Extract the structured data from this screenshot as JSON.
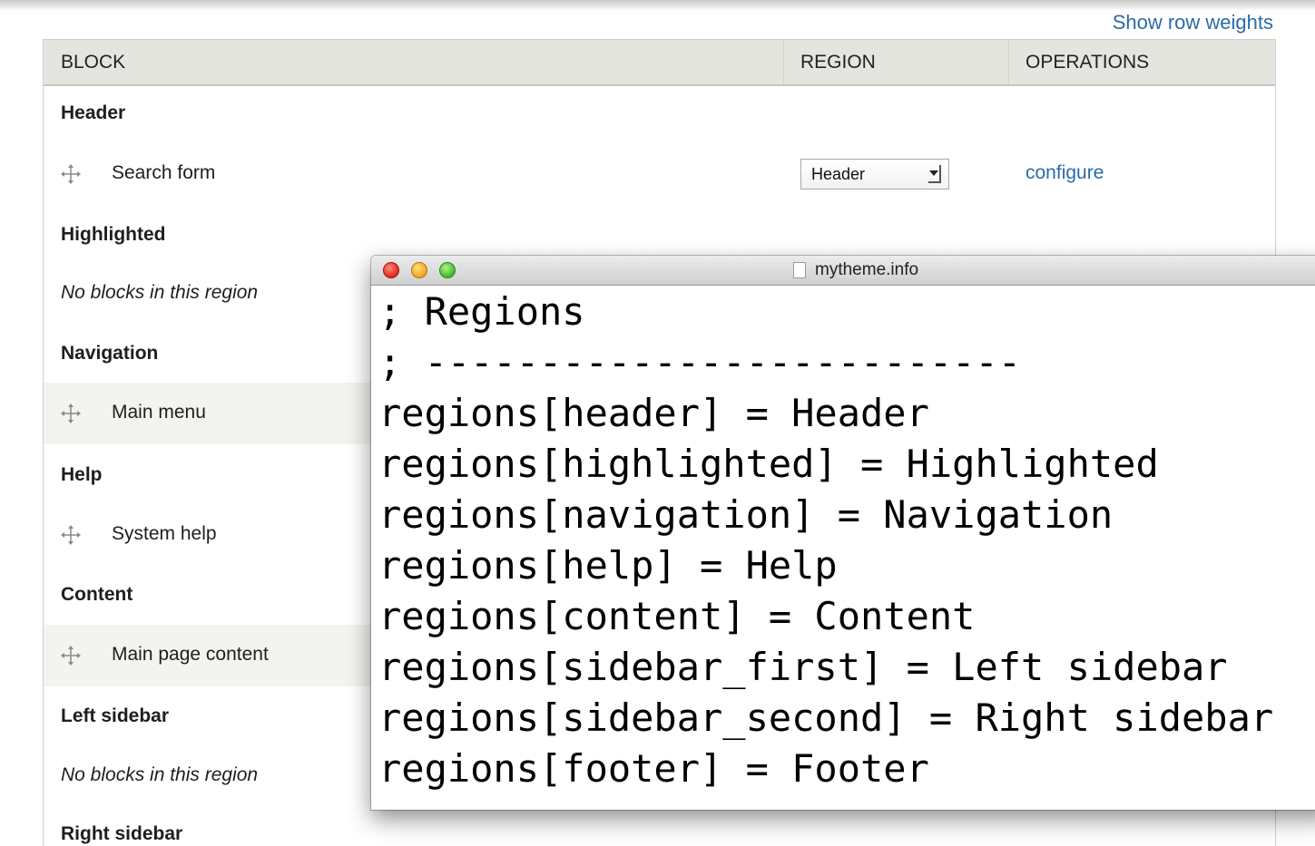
{
  "toolbar": {
    "show_row_weights": "Show row weights"
  },
  "table": {
    "headers": {
      "block": "BLOCK",
      "region": "REGION",
      "operations": "OPERATIONS"
    },
    "regions": [
      {
        "title": "Header",
        "blocks": [
          {
            "label": "Search form",
            "region_value": "Header",
            "operation": "configure"
          }
        ]
      },
      {
        "title": "Highlighted",
        "empty": "No blocks in this region"
      },
      {
        "title": "Navigation",
        "blocks": [
          {
            "label": "Main menu"
          }
        ]
      },
      {
        "title": "Help",
        "blocks": [
          {
            "label": "System help"
          }
        ]
      },
      {
        "title": "Content",
        "blocks": [
          {
            "label": "Main page content"
          }
        ]
      },
      {
        "title": "Left sidebar",
        "empty": "No blocks in this region"
      },
      {
        "title": "Right sidebar"
      }
    ]
  },
  "editor": {
    "filename": "mytheme.info",
    "lines": [
      "; Regions",
      "; --------------------------",
      "regions[header] = Header",
      "regions[highlighted] = Highlighted",
      "regions[navigation] = Navigation",
      "regions[help] = Help",
      "regions[content] = Content",
      "regions[sidebar_first] = Left sidebar",
      "regions[sidebar_second] = Right sidebar",
      "regions[footer] = Footer"
    ]
  },
  "colors": {
    "link": "#2a6ba8",
    "header_bg": "#e4e5df",
    "stripe_bg": "#f3f3ef"
  }
}
